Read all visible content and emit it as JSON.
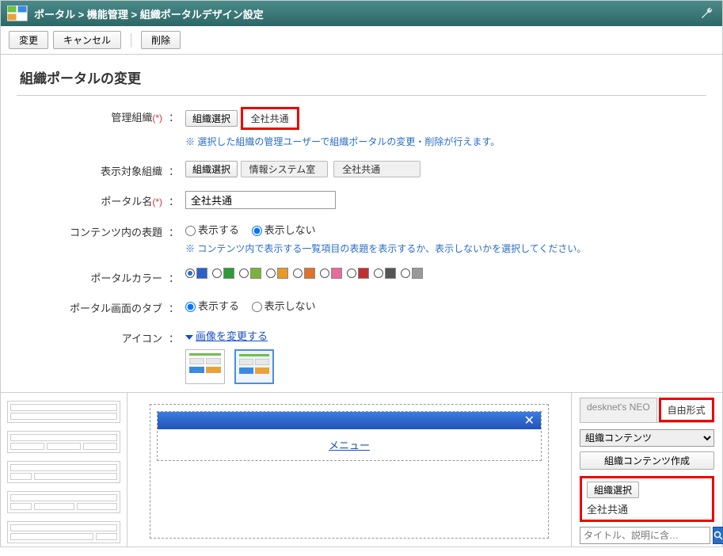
{
  "breadcrumb": {
    "p1": "ポータル",
    "sep": " > ",
    "p2": "機能管理",
    "p3": "組織ポータルデザイン設定"
  },
  "toolbar": {
    "change": "変更",
    "cancel": "キャンセル",
    "delete": "削除"
  },
  "title": "組織ポータルの変更",
  "labels": {
    "manage_org": "管理組織",
    "target_org": "表示対象組織",
    "portal_name": "ポータル名",
    "content_title": "コンテンツ内の表題",
    "portal_color": "ポータルカラー",
    "portal_tab": "ポータル画面のタブ",
    "icon": "アイコン",
    "req": "(*)",
    "colon": "："
  },
  "manage_org": {
    "select_btn": "組織選択",
    "value": "全社共通",
    "note": "※ 選択した組織の管理ユーザーで組織ポータルの変更・削除が行えます。"
  },
  "target_org": {
    "select_btn": "組織選択",
    "tag1": "情報システム室",
    "tag2": "全社共通"
  },
  "portal_name": {
    "value": "全社共通"
  },
  "content_title": {
    "opt_show": "表示する",
    "opt_hide": "表示しない",
    "selected": "hide",
    "note": "※ コンテンツ内で表示する一覧項目の表題を表示するか、表示しないかを選択してください。"
  },
  "portal_color": {
    "colors": [
      "#2a62c8",
      "#2e9a3a",
      "#7bb33a",
      "#e69a28",
      "#e0702a",
      "#e86a9a",
      "#c03030",
      "#555",
      "#999"
    ],
    "selected_index": 0
  },
  "portal_tab": {
    "opt_show": "表示する",
    "opt_hide": "表示しない",
    "selected": "show"
  },
  "icon": {
    "link": "画像を変更する"
  },
  "canvas": {
    "menu_label": "メニュー"
  },
  "right": {
    "tab1": "desknet's NEO",
    "tab2": "自由形式",
    "dropdown": "組織コンテンツ",
    "create_btn": "組織コンテンツ作成",
    "org_select_btn": "組織選択",
    "org_value": "全社共通",
    "search_placeholder": "タイトル、説明に含…"
  }
}
